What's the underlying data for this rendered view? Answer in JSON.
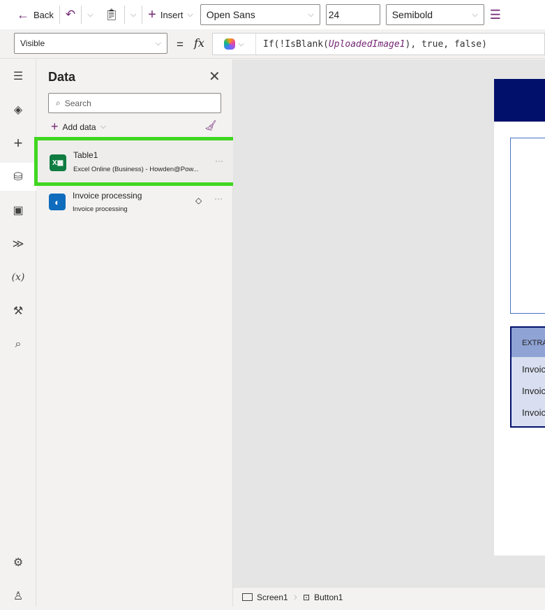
{
  "toolbar": {
    "back": "Back",
    "insert": "Insert",
    "font": "Open Sans",
    "font_size": "24",
    "font_weight": "Semibold"
  },
  "formula": {
    "property": "Visible",
    "eq": "=",
    "fx": "fx",
    "expr_prefix": "If(!IsBlank(",
    "expr_ref": "UploadedImage1",
    "expr_suffix": "), true, false)"
  },
  "panel": {
    "title": "Data",
    "search_placeholder": "Search",
    "add_data": "Add data",
    "items": [
      {
        "name": "Table1",
        "subtitle": "Excel Online (Business) - Howden@Pow...",
        "selected": true
      },
      {
        "name": "Invoice processing",
        "subtitle": "Invoice processing",
        "premium": true
      }
    ]
  },
  "canvas": {
    "table_header": "EXTRA",
    "rows": [
      "Invoic",
      "Invoic",
      "Invoic"
    ]
  },
  "status": {
    "screen": "Screen1",
    "control": "Button1"
  },
  "colors": {
    "accent": "#742774",
    "highlight": "#3fd71f",
    "header": "#00106b"
  }
}
